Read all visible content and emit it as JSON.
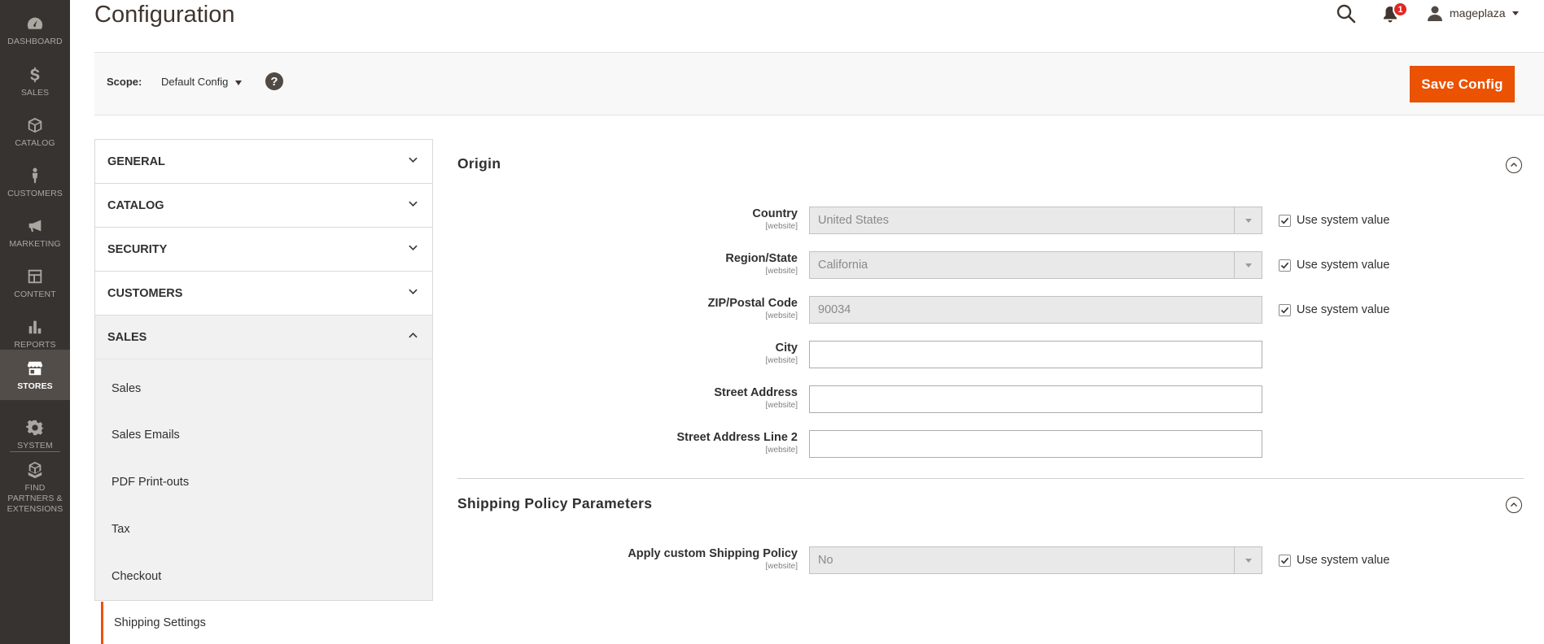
{
  "admin_menu": {
    "items": [
      {
        "label": "Dashboard",
        "icon": "dashboard-icon"
      },
      {
        "label": "Sales",
        "icon": "dollar-icon"
      },
      {
        "label": "Catalog",
        "icon": "box-icon"
      },
      {
        "label": "Customers",
        "icon": "person-icon"
      },
      {
        "label": "Marketing",
        "icon": "megaphone-icon"
      },
      {
        "label": "Content",
        "icon": "layout-icon"
      },
      {
        "label": "Reports",
        "icon": "bar-chart-icon"
      },
      {
        "label": "Stores",
        "icon": "store-icon"
      },
      {
        "label": "System",
        "icon": "gear-icon"
      },
      {
        "label": "Find Partners & Extensions",
        "icon": "boxes-icon"
      }
    ],
    "active": "Stores"
  },
  "header": {
    "title": "Configuration",
    "notification_count": "1",
    "username": "mageplaza"
  },
  "scope_bar": {
    "label": "Scope:",
    "value": "Default Config",
    "save_label": "Save Config"
  },
  "tabs": {
    "groups": [
      {
        "label": "GENERAL"
      },
      {
        "label": "CATALOG"
      },
      {
        "label": "SECURITY"
      },
      {
        "label": "CUSTOMERS"
      },
      {
        "label": "SALES"
      }
    ],
    "sales_children": [
      "Sales",
      "Sales Emails",
      "PDF Print-outs",
      "Tax",
      "Checkout"
    ],
    "active_child": "Shipping Settings"
  },
  "origin": {
    "title": "Origin",
    "fields": [
      {
        "label": "Country",
        "scope": "[website]",
        "value": "United States",
        "use_system": "Use system value"
      },
      {
        "label": "Region/State",
        "scope": "[website]",
        "value": "California",
        "use_system": "Use system value"
      },
      {
        "label": "ZIP/Postal Code",
        "scope": "[website]",
        "value": "90034",
        "use_system": "Use system value"
      },
      {
        "label": "City",
        "scope": "[website]",
        "value": ""
      },
      {
        "label": "Street Address",
        "scope": "[website]",
        "value": ""
      },
      {
        "label": "Street Address Line 2",
        "scope": "[website]",
        "value": ""
      }
    ]
  },
  "shipping_policy": {
    "title": "Shipping Policy Parameters",
    "fields": [
      {
        "label": "Apply custom Shipping Policy",
        "scope": "[website]",
        "value": "No",
        "use_system": "Use system value"
      }
    ]
  },
  "colors": {
    "menu_bg": "#373330",
    "menu_active": "#524d49",
    "accent": "#eb5202",
    "badge": "#e22626"
  }
}
